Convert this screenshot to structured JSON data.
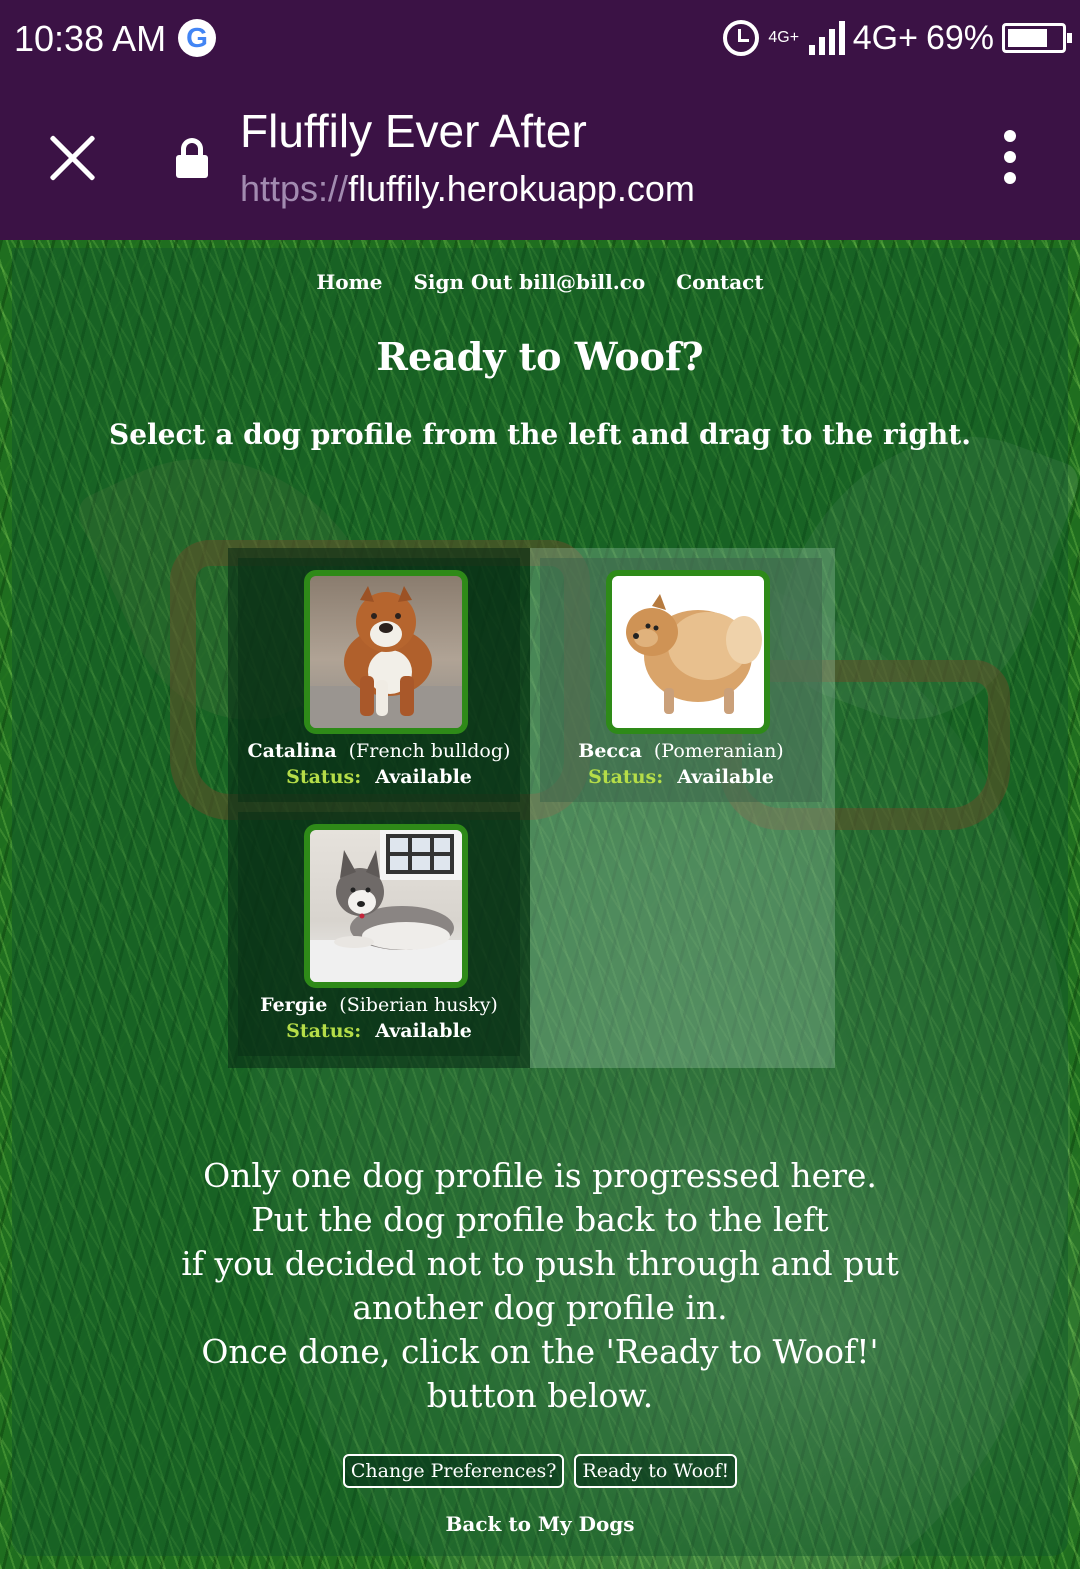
{
  "status_bar": {
    "time": "10:38 AM",
    "google_letter": "G",
    "network_small": "4G+",
    "network": "4G+",
    "battery": "69%",
    "icons": [
      "google-icon",
      "alarm-icon",
      "signal-icon",
      "battery-icon"
    ]
  },
  "browser": {
    "page_title": "Fluffily Ever After",
    "url_scheme": "https://",
    "url_host": "fluffily.herokuapp.com",
    "icons": [
      "close-icon",
      "lock-icon",
      "more-vert-icon"
    ],
    "toolbar_color": "#3b1245"
  },
  "nav": {
    "items": [
      {
        "label": "Home"
      },
      {
        "label": "Sign Out bill@bill.co"
      },
      {
        "label": "Contact"
      }
    ]
  },
  "heading": "Ready to Woof?",
  "instruction": "Select a dog profile from the left and drag to the right.",
  "left_column": {
    "dogs": [
      {
        "name": "Catalina",
        "breed": "(French bulldog)",
        "status_label": "Status:",
        "status": "Available",
        "photo": "french-bulldog-photo"
      },
      {
        "name": "Fergie",
        "breed": "(Siberian husky)",
        "status_label": "Status:",
        "status": "Available",
        "photo": "siberian-husky-photo"
      }
    ]
  },
  "right_column": {
    "dogs": [
      {
        "name": "Becca",
        "breed": "(Pomeranian)",
        "status_label": "Status:",
        "status": "Available",
        "photo": "pomeranian-photo"
      }
    ]
  },
  "note_lines": [
    "Only one dog profile is progressed here.",
    "Put the dog profile back to the left",
    "if you decided not to push through and put",
    "another dog profile in.",
    "Once done, click on the 'Ready to Woof!'",
    "button below."
  ],
  "buttons": {
    "change_preferences": "Change Preferences?",
    "ready_to_woof": "Ready to Woof!"
  },
  "back_link": "Back to My Dogs",
  "colors": {
    "status_label": "#b5dd48",
    "photo_border": "#2e8a18",
    "grass": "#1f6e1f"
  }
}
